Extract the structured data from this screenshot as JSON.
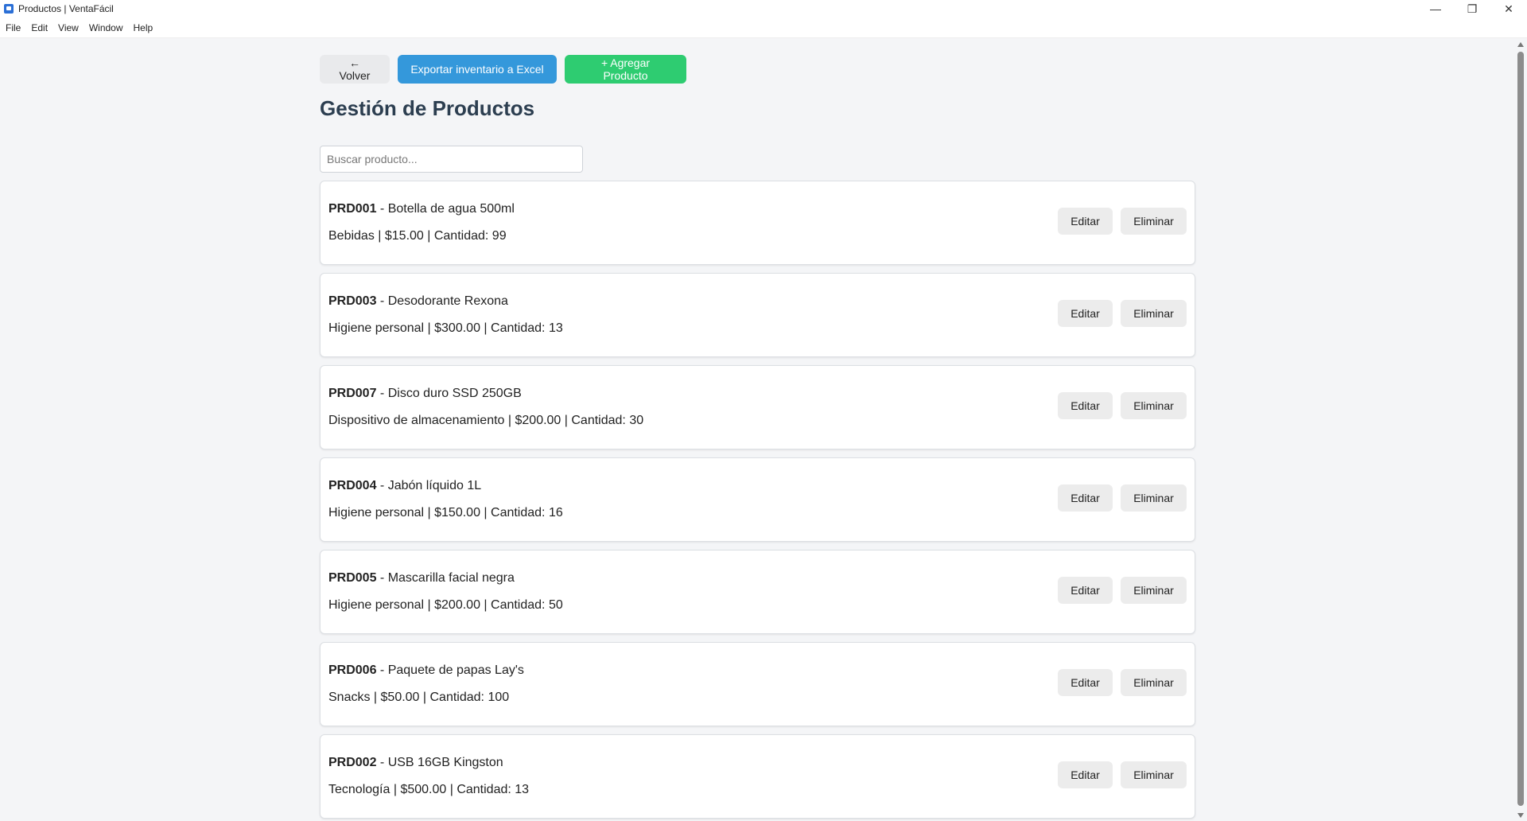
{
  "window": {
    "title": "Productos | VentaFácil",
    "minimize_glyph": "—",
    "maximize_glyph": "❐",
    "close_glyph": "✕"
  },
  "menu": [
    "File",
    "Edit",
    "View",
    "Window",
    "Help"
  ],
  "toolbar": {
    "back_label": "← Volver",
    "export_label": "Exportar inventario a Excel",
    "add_label": "+ Agregar Producto"
  },
  "page_title": "Gestión de Productos",
  "search": {
    "placeholder": "Buscar producto...",
    "value": ""
  },
  "actions": {
    "edit_label": "Editar",
    "delete_label": "Eliminar"
  },
  "products": [
    {
      "code": "PRD001",
      "name": " - Botella de agua 500ml",
      "details": "Bebidas | $15.00 | Cantidad: 99"
    },
    {
      "code": "PRD003",
      "name": " - Desodorante Rexona",
      "details": "Higiene personal | $300.00 | Cantidad: 13"
    },
    {
      "code": "PRD007",
      "name": " - Disco duro SSD 250GB",
      "details": "Dispositivo de almacenamiento | $200.00 | Cantidad: 30"
    },
    {
      "code": "PRD004",
      "name": " - Jabón líquido 1L",
      "details": "Higiene personal | $150.00 | Cantidad: 16"
    },
    {
      "code": "PRD005",
      "name": " - Mascarilla facial negra",
      "details": "Higiene personal | $200.00 | Cantidad: 50"
    },
    {
      "code": "PRD006",
      "name": " - Paquete de papas Lay's",
      "details": "Snacks | $50.00 | Cantidad: 100"
    },
    {
      "code": "PRD002",
      "name": " - USB 16GB Kingston",
      "details": "Tecnología | $500.00 | Cantidad: 13"
    }
  ],
  "colors": {
    "export_button": "#3498db",
    "add_button": "#2ecc71",
    "title": "#2c3e50"
  }
}
